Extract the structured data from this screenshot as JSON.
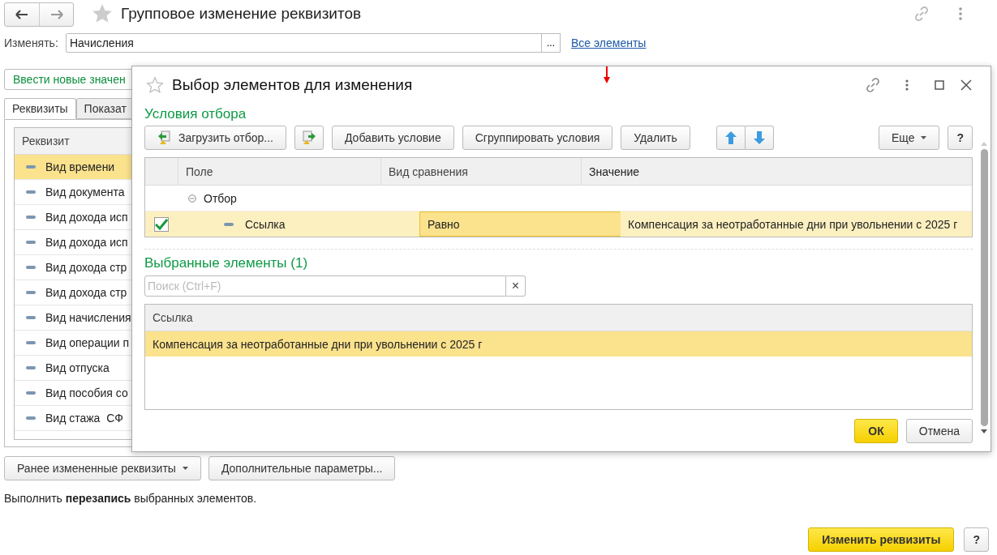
{
  "window": {
    "title": "Групповое изменение реквизитов"
  },
  "change": {
    "label": "Изменять:",
    "value": "Начисления",
    "select_button": "...",
    "link": "Все элементы"
  },
  "enter_button": "Ввести новые значен",
  "tabs": [
    {
      "label": "Реквизиты",
      "selected": true
    },
    {
      "label": "Показат",
      "selected": false
    }
  ],
  "attributes_table": {
    "columns": [
      "Реквизит"
    ],
    "rows": [
      {
        "name": "Вид времени",
        "selected": true
      },
      {
        "name": "Вид документа",
        "selected": false
      },
      {
        "name": "Вид дохода исп",
        "selected": false
      },
      {
        "name": "Вид дохода исп",
        "selected": false
      },
      {
        "name": "Вид дохода стр",
        "selected": false
      },
      {
        "name": "Вид дохода стр",
        "selected": false
      },
      {
        "name": "Вид начисления",
        "selected": false
      },
      {
        "name": "Вид операции п",
        "selected": false
      },
      {
        "name": "Вид отпуска",
        "selected": false
      },
      {
        "name": "Вид пособия со",
        "selected": false
      },
      {
        "name": "Вид стажа  СФ",
        "selected": false
      }
    ]
  },
  "bottom_buttons": [
    {
      "label": "Ранее измененные реквизиты",
      "dropdown": true
    },
    {
      "label": "Дополнительные параметры...",
      "dropdown": false
    }
  ],
  "summary": "Выполнить **перезапись** выбранных элементов.",
  "footer": {
    "primary": "Изменить реквизиты",
    "help": "?"
  },
  "dialog": {
    "title": "Выбор элементов для изменения",
    "filter_heading": "Условия отбора",
    "toolbar": [
      {
        "kind": "load",
        "label": "Загрузить отбор..."
      },
      {
        "kind": "save"
      },
      {
        "kind": "text",
        "label": "Добавить условие"
      },
      {
        "kind": "text",
        "label": "Сгруппировать условия"
      },
      {
        "kind": "text",
        "label": "Удалить"
      },
      {
        "kind": "arrows"
      }
    ],
    "more": "Еще",
    "help": "?",
    "filter_table": {
      "columns": [
        "Поле",
        "Вид сравнения",
        "Значение"
      ],
      "rows": [
        {
          "kind": "group",
          "field": "Отбор",
          "expanded": true
        },
        {
          "kind": "condition",
          "checked": true,
          "selected": true,
          "field": "Ссылка",
          "comparison": "Равно",
          "value": "Компенсация за неотработанные дни при увольнении с 2025 г"
        }
      ]
    },
    "selected_heading": "Выбранные элементы (1)",
    "search": {
      "placeholder": "Поиск (Ctrl+F)",
      "clear": "×"
    },
    "selected_table": {
      "columns": [
        "Ссылка"
      ],
      "rows": [
        {
          "value": "Компенсация за неотработанные дни при увольнении с 2025 г",
          "selected": true
        }
      ]
    },
    "buttons": [
      {
        "label": "ОК",
        "default": true
      },
      {
        "label": "Отмена",
        "default": false
      }
    ]
  }
}
